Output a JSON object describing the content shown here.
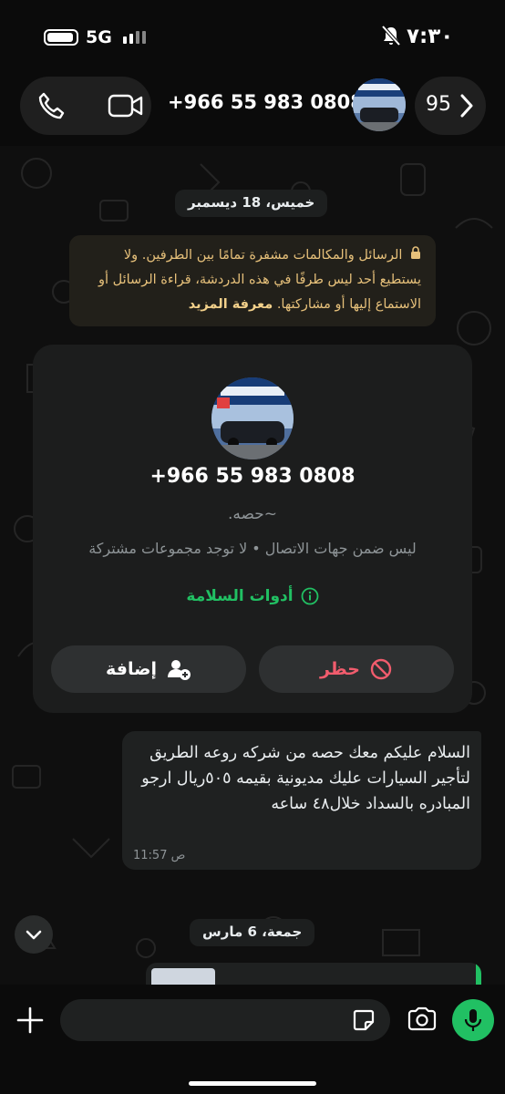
{
  "status_bar": {
    "network": "5G",
    "time": "٧:٣٠"
  },
  "header": {
    "title": "+966 55 983 0808",
    "back_count": "95"
  },
  "chips": {
    "first_date": "خميس، 18 ديسمبر",
    "second_date": "جمعة، 6 مارس"
  },
  "encryption_notice": {
    "text": "الرسائل والمكالمات مشفرة تمامًا بين الطرفين. ولا يستطيع أحد ليس طرفًا في هذه الدردشة، قراءة الرسائل أو الاستماع إليها أو مشاركتها.",
    "link": "معرفة المزيد"
  },
  "contact_card": {
    "number": "+966 55 983 0808",
    "name": "~حصه.",
    "info": "ليس ضمن جهات الاتصال • لا توجد مجموعات مشتركة",
    "safety_tools": "أدوات السلامة",
    "block_label": "حظر",
    "add_label": "إضافة"
  },
  "message": {
    "text": "السلام عليكم معك حصه من شركه روعه الطريق لتأجير السيارات عليك مديونية بقيمه ٥٠٥ريال ارجو المبادره بالسداد خلال٤٨ ساعه",
    "time": "11:57 ص"
  },
  "composer": {
    "placeholder": ""
  },
  "colors": {
    "accent": "#21c063",
    "danger": "#f15c6d",
    "notice_text": "#e6c07a"
  },
  "icons": [
    "battery-icon",
    "signal-icon",
    "bell-off-icon",
    "phone-icon",
    "video-icon",
    "chevron-right-icon",
    "lock-icon",
    "info-icon",
    "block-icon",
    "add-person-icon",
    "chevron-down-icon",
    "plus-icon",
    "sticker-icon",
    "camera-icon",
    "mic-icon"
  ]
}
